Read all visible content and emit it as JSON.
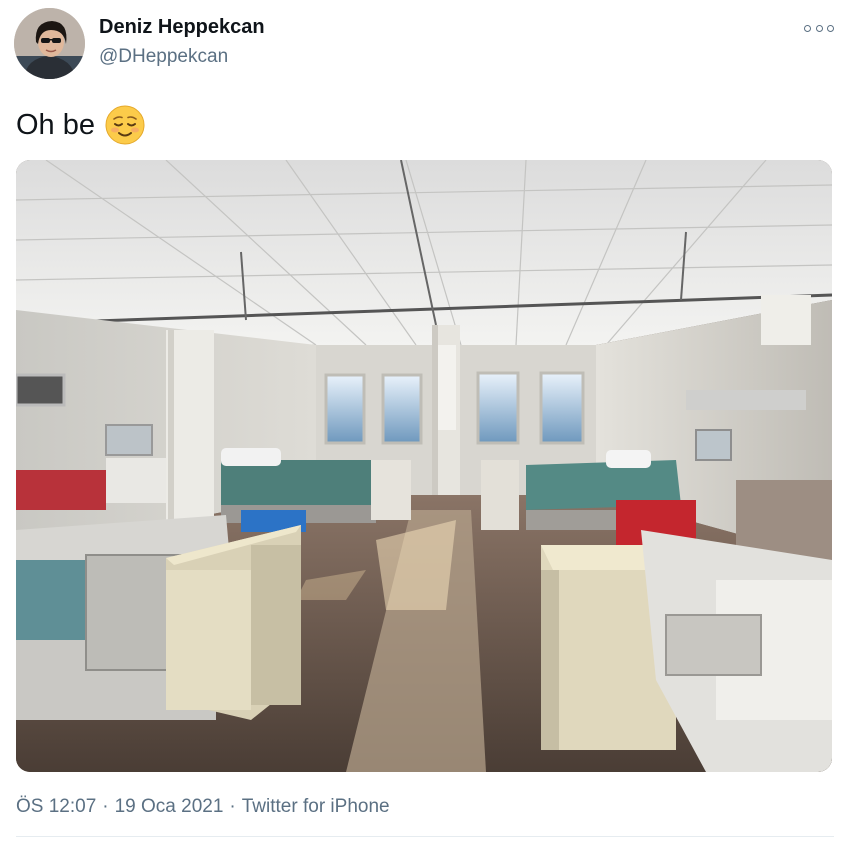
{
  "author": {
    "display_name": "Deniz Heppekcan",
    "handle": "@DHeppekcan",
    "avatar_icon": "profile-avatar"
  },
  "menu": {
    "icon": "more-options-icon"
  },
  "tweet": {
    "text": "Oh be",
    "emoji": "relieved-face-emoji"
  },
  "media": {
    "type": "photo",
    "icon": "hospital-ward-photo"
  },
  "footer": {
    "time": "ÖS 12:07",
    "separator_1": "·",
    "date": "19 Oca 2021",
    "separator_2": "·",
    "source": "Twitter for iPhone"
  },
  "colors": {
    "text_primary": "#0f1419",
    "text_secondary": "#5b7083",
    "divider": "#e6ecf0"
  }
}
